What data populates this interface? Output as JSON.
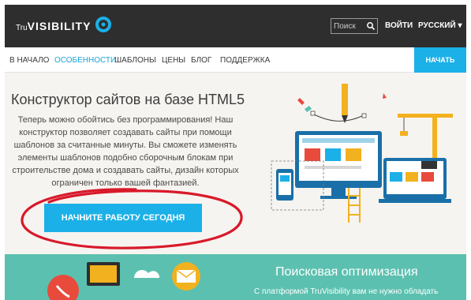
{
  "header": {
    "logo_prefix": "Tru",
    "logo_name": "VISIBILITY",
    "search_placeholder": "Поиск",
    "login_label": "ВОЙТИ",
    "language_label": "РУССКИЙ ▾"
  },
  "nav": {
    "items": [
      {
        "label": "В НАЧАЛО",
        "active": false
      },
      {
        "label": "ОСОБЕННОСТИ",
        "active": true
      },
      {
        "label": "ШАБЛОНЫ",
        "active": false
      },
      {
        "label": "ЦЕНЫ",
        "active": false
      },
      {
        "label": "БЛОГ",
        "active": false
      },
      {
        "label": "ПОДДЕРЖКА",
        "active": false
      }
    ],
    "start_label": "НАЧАТЬ"
  },
  "hero": {
    "title": "Конструктор сайтов на базе HTML5",
    "text": "Теперь можно обойтись без программирования! Наш конструктор позволяет создавать сайты при помощи шаблонов за считанные минуты. Вы сможете изменять элементы шаблонов подобно сборочным блокам при строительстве дома и создавать сайты, дизайн которых ограничен только вашей фантазией.",
    "cta_label": "НАЧНИТЕ РАБОТУ СЕГОДНЯ"
  },
  "band": {
    "title": "Поисковая оптимизация",
    "text": "С платформой TruVisibility вам не нужно обладать"
  },
  "colors": {
    "accent": "#1bb0e8",
    "topbar": "#2e2e2e",
    "band": "#5cc0b0",
    "annotation": "#d8192a"
  }
}
